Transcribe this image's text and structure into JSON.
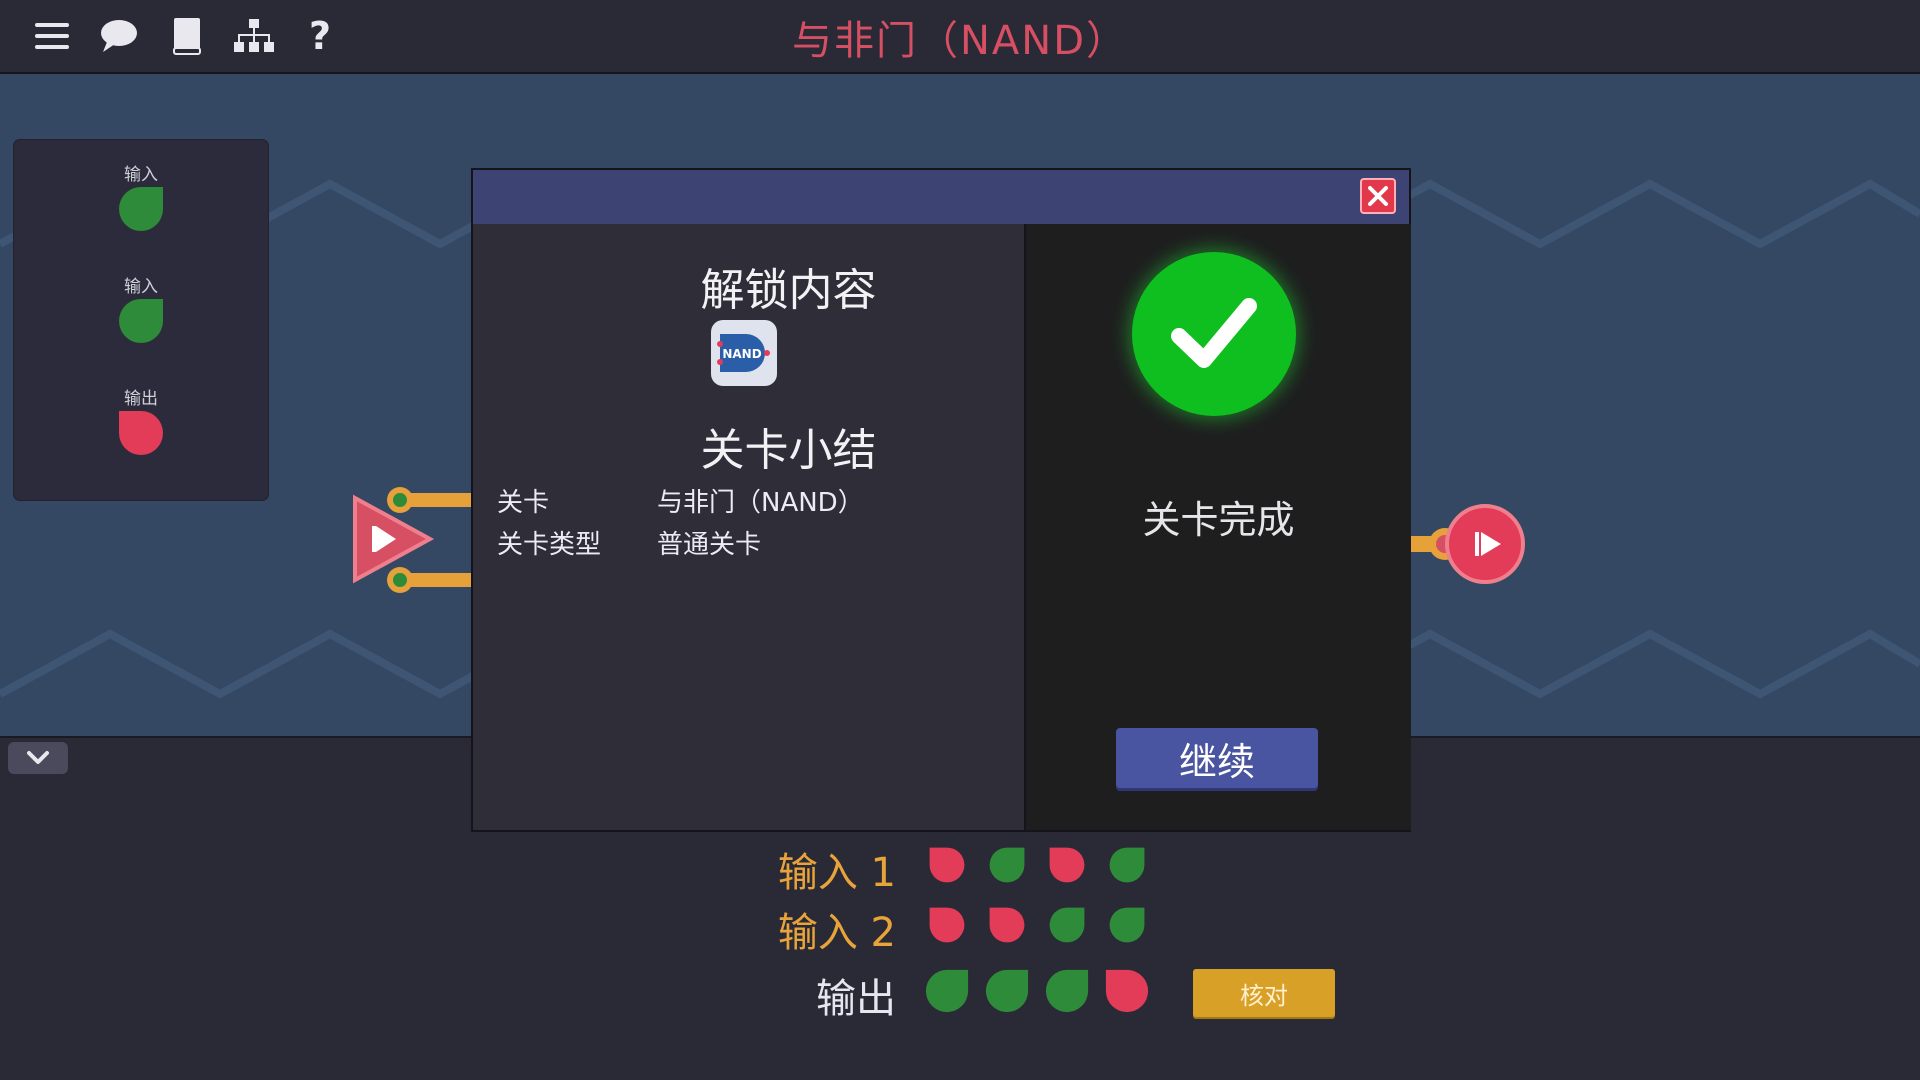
{
  "header": {
    "title": "与非门（NAND）",
    "icons": [
      "menu-icon",
      "chat-icon",
      "book-icon",
      "hierarchy-icon",
      "help-icon"
    ]
  },
  "io_panel": {
    "items": [
      {
        "label": "输入",
        "state": "on"
      },
      {
        "label": "输入",
        "state": "on"
      },
      {
        "label": "输出",
        "state": "off"
      }
    ]
  },
  "modal": {
    "unlock_heading": "解锁内容",
    "chip_label": "NAND",
    "summary_heading": "关卡小结",
    "rows": [
      {
        "key": "关卡",
        "value": "与非门（NAND）"
      },
      {
        "key": "关卡类型",
        "value": "普通关卡"
      }
    ],
    "complete_text": "关卡完成",
    "continue_label": "继续"
  },
  "truth_table": {
    "rows": [
      {
        "label": "输入 1",
        "values": [
          "off",
          "on",
          "off",
          "on"
        ]
      },
      {
        "label": "输入 2",
        "values": [
          "off",
          "off",
          "on",
          "on"
        ]
      },
      {
        "label": "输出",
        "values": [
          "on",
          "on",
          "on",
          "off"
        ]
      }
    ],
    "check_label": "核对"
  },
  "colors": {
    "on": "#2e8b3a",
    "off": "#e23c59",
    "accent_title": "#d64f62",
    "success": "#0fbf1f",
    "check_button": "#d9a028"
  }
}
